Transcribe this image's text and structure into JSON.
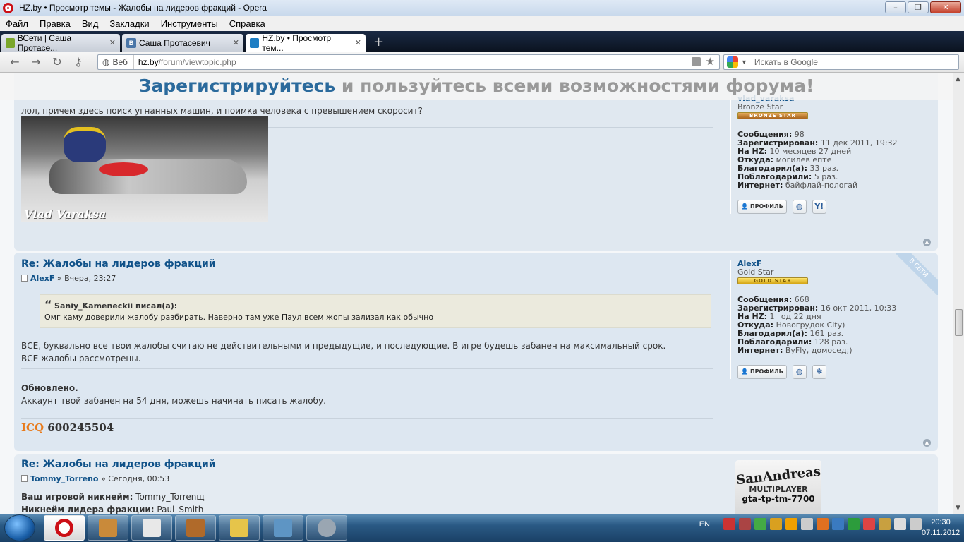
{
  "window": {
    "title": "HZ.by • Просмотр темы - Жалобы на лидеров фракций - Opera",
    "minimize": "–",
    "maximize": "❐",
    "close": "✕"
  },
  "menu": [
    "Файл",
    "Правка",
    "Вид",
    "Закладки",
    "Инструменты",
    "Справка"
  ],
  "tabs": [
    {
      "label": "ВСети | Саша Протасе...",
      "icon_color": "#7aa62b",
      "icon_text": "",
      "active": false
    },
    {
      "label": "Саша Протасевич",
      "icon_color": "#4a76a8",
      "icon_text": "B",
      "active": false
    },
    {
      "label": "HZ.by • Просмотр тем...",
      "icon_color": "#1d7ec4",
      "icon_text": "",
      "active": true
    }
  ],
  "new_tab": "+",
  "address": {
    "web_badge": "Веб",
    "host": "hz.by",
    "path": "/forum/viewtopic.php",
    "search_placeholder": "Искать в Google"
  },
  "banner": {
    "highlight": "Зарегистрируйтесь",
    "rest": " и пользуйтесь всеми возможностями форума!"
  },
  "posts": [
    {
      "text": "лол, причем здесь поиск угнанных машин, и поимка человека с превышением скоросит?",
      "signature_text": "Vlad Varaksa",
      "profile": {
        "username": "vlad_varaksa",
        "rank": "Bronze Star",
        "rank_badge": "BRONZE STAR",
        "stats": [
          {
            "label": "Сообщения:",
            "value": "98"
          },
          {
            "label": "Зарегистрирован:",
            "value": "11 дек 2011, 19:32"
          },
          {
            "label": "На HZ:",
            "value": "10 месяцев 27 дней"
          },
          {
            "label": "Откуда:",
            "value": "могилев ёпте"
          },
          {
            "label": "Благодарил(а):",
            "value": "33 раз."
          },
          {
            "label": "Поблагодарили:",
            "value": "5 раз."
          },
          {
            "label": "Интернет:",
            "value": "байфлай-пологай"
          }
        ],
        "profile_btn": "ПРОФИЛЬ"
      }
    },
    {
      "title": "Re: Жалобы на лидеров фракций",
      "author": "AlexF",
      "date": "Вчера, 23:27",
      "online": "В СЕТИ",
      "quote_author": "Saniy_Kameneckii писал(а):",
      "quote_text": "Омг каму доверили жалобу разбирать. Наверно там уже Паул всем жопы зализал как обычно",
      "text1": "ВСЕ, буквально все твои жалобы считаю не действительными и предыдущие, и последующие. В игре будешь забанен на максимальный срок.",
      "text2": "ВСЕ жалобы рассмотрены.",
      "update_title": "Обновлено.",
      "update_text": "Аккаунт твой забанен на 54 дня, можешь начинать писать жалобу.",
      "icq_label": "ICQ",
      "icq_number": "600245504",
      "profile": {
        "username": "AlexF",
        "rank": "Gold Star",
        "rank_badge": "GOLD STAR",
        "stats": [
          {
            "label": "Сообщения:",
            "value": "668"
          },
          {
            "label": "Зарегистрирован:",
            "value": "16 окт 2011, 10:33"
          },
          {
            "label": "На HZ:",
            "value": "1 год 22 дня"
          },
          {
            "label": "Откуда:",
            "value": "Новогрудок City)"
          },
          {
            "label": "Благодарил(а):",
            "value": "161 раз."
          },
          {
            "label": "Поблагодарили:",
            "value": "128 раз."
          },
          {
            "label": "Интернет:",
            "value": "ByFly, домосед;)"
          }
        ],
        "profile_btn": "ПРОФИЛЬ"
      }
    },
    {
      "title": "Re: Жалобы на лидеров фракций",
      "author": "Tommy_Torreno",
      "date": "Сегодня, 00:53",
      "line1_label": "Ваш игровой никнейм:",
      "line1_value": "Tommy_Torrenщ",
      "line2_label": "Никнейм лидера фракции:",
      "line2_value": "Paul_Smith",
      "avatar": {
        "line1": "SanAndreas",
        "line2": "MULTIPLAYER",
        "line3": "gta-tp-tm-7700"
      }
    }
  ],
  "taskbar": {
    "lang": "EN",
    "time": "20:30",
    "date": "07.11.2012"
  }
}
